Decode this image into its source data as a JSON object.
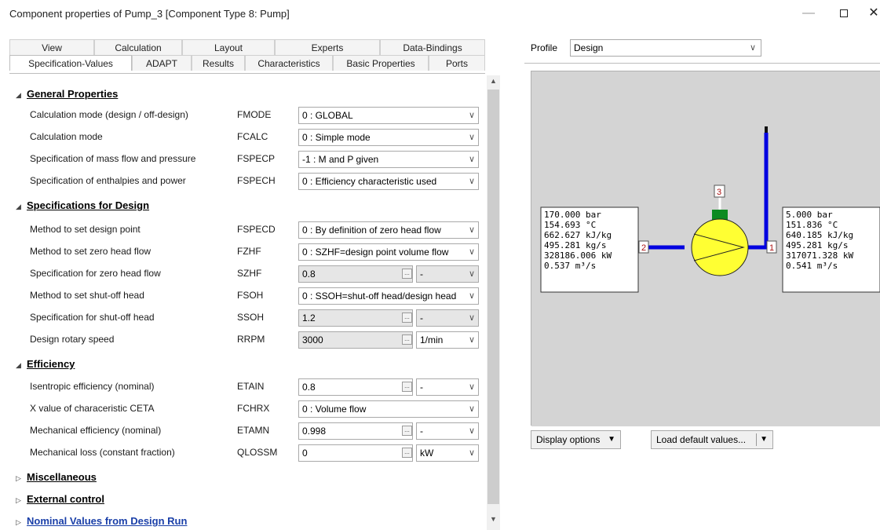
{
  "window": {
    "title": "Component properties of Pump_3  [Component Type 8: Pump]",
    "min_icon": "minimize-icon",
    "max_icon": "maximize-icon",
    "close_icon": "close-icon",
    "close_glyph": "✕",
    "min_glyph": "—"
  },
  "tabs": {
    "row1": [
      "View",
      "Calculation",
      "Layout",
      "Experts",
      "Data-Bindings"
    ],
    "row2": [
      "Specification-Values",
      "ADAPT",
      "Results",
      "Characteristics",
      "Basic Properties",
      "Ports"
    ],
    "active": "Specification-Values"
  },
  "sections": {
    "general": "General Properties",
    "design": "Specifications for Design",
    "efficiency": "Efficiency",
    "misc": "Miscellaneous",
    "external": "External control",
    "nominal": "Nominal Values from Design Run"
  },
  "properties": {
    "fmode": {
      "label": "Calculation mode (design / off-design)",
      "key": "FMODE",
      "value": "0 : GLOBAL"
    },
    "fcalc": {
      "label": "Calculation mode",
      "key": "FCALC",
      "value": "0 : Simple mode"
    },
    "fspecp": {
      "label": "Specification of mass flow and pressure",
      "key": "FSPECP",
      "value": "-1 : M and P given"
    },
    "fspech": {
      "label": "Specification of enthalpies and power",
      "key": "FSPECH",
      "value": "0 : Efficiency characteristic used"
    },
    "fspecd": {
      "label": "Method to set design point",
      "key": "FSPECD",
      "value": "0 : By definition of zero head flow"
    },
    "fzhf": {
      "label": "Method to set zero head flow",
      "key": "FZHF",
      "value": "0 : SZHF=design point volume flow"
    },
    "szhf": {
      "label": "Specification for zero head flow",
      "key": "SZHF",
      "value": "0.8",
      "unit": "-"
    },
    "fsoh": {
      "label": "Method to set shut-off head",
      "key": "FSOH",
      "value": "0 : SSOH=shut-off head/design head"
    },
    "ssoh": {
      "label": "Specification for shut-off head",
      "key": "SSOH",
      "value": "1.2",
      "unit": "-"
    },
    "rrpm": {
      "label": "Design rotary speed",
      "key": "RRPM",
      "value": "3000",
      "unit": "1/min"
    },
    "etain": {
      "label": "Isentropic efficiency (nominal)",
      "key": "ETAIN",
      "value": "0.8",
      "unit": "-"
    },
    "fchrx": {
      "label": "X value of characeristic CETA",
      "key": "FCHRX",
      "value": "0 : Volume flow"
    },
    "etamn": {
      "label": "Mechanical efficiency (nominal)",
      "key": "ETAMN",
      "value": "0.998",
      "unit": "-"
    },
    "qlossm": {
      "label": "Mechanical loss (constant fraction)",
      "key": "QLOSSM",
      "value": "0",
      "unit": "kW"
    }
  },
  "profile": {
    "label": "Profile",
    "value": "Design"
  },
  "diagram": {
    "inlet": [
      "170.000 bar",
      "154.693 °C",
      "662.627 kJ/kg",
      "495.281 kg/s",
      "328186.006 kW",
      "0.537 m³/s"
    ],
    "outlet": [
      "5.000 bar",
      "151.836 °C",
      "640.185 kJ/kg",
      "495.281 kg/s",
      "317071.328 kW",
      "0.541 m³/s"
    ],
    "port1": "1",
    "port2": "2",
    "port3": "3",
    "colors": {
      "pipe": "#0000e0",
      "pump": "#ffff33",
      "motor": "#0c8a20",
      "background": "#d4d4d4"
    }
  },
  "buttons": {
    "display": "Display options",
    "load": "Load default values..."
  }
}
